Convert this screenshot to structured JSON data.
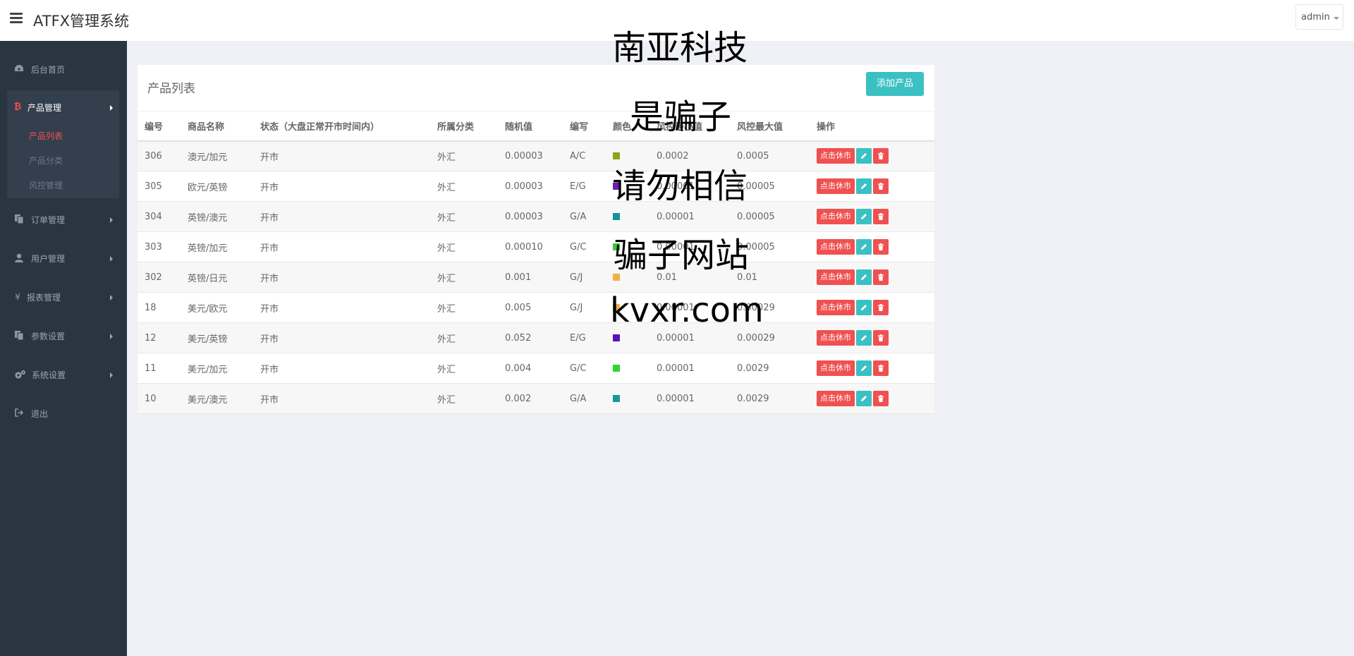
{
  "header": {
    "title": "ATFX管理系统",
    "user": "admin"
  },
  "sidebar": {
    "items": [
      {
        "label": "后台首页",
        "icon": "dashboard-icon"
      },
      {
        "label": "产品管理",
        "icon": "bitcoin-icon"
      },
      {
        "label": "订单管理",
        "icon": "copy-icon"
      },
      {
        "label": "用户管理",
        "icon": "user-icon"
      },
      {
        "label": "报表管理",
        "icon": "yen-icon"
      },
      {
        "label": "参数设置",
        "icon": "copy-icon"
      },
      {
        "label": "系统设置",
        "icon": "cogs-icon"
      },
      {
        "label": "退出",
        "icon": "sign-out-icon"
      }
    ],
    "subitems": [
      {
        "label": "产品列表"
      },
      {
        "label": "产品分类"
      },
      {
        "label": "风控管理"
      }
    ]
  },
  "panel": {
    "title": "产品列表",
    "add_label": "添加产品",
    "columns": [
      "编号",
      "商品名称",
      "状态（大盘正常开市时间内）",
      "所属分类",
      "随机值",
      "编写",
      "颜色",
      "风控最小值",
      "风控最大值",
      "操作"
    ],
    "rest_label": "点击休市",
    "rows": [
      {
        "id": "306",
        "name": "澳元/加元",
        "status": "开市",
        "category": "外汇",
        "random": "0.00003",
        "code": "A/C",
        "color": "#8aa516",
        "min": "0.0002",
        "max": "0.0005"
      },
      {
        "id": "305",
        "name": "欧元/英镑",
        "status": "开市",
        "category": "外汇",
        "random": "0.00003",
        "code": "E/G",
        "color": "#6a1bb5",
        "min": "0.00001",
        "max": "0.00005"
      },
      {
        "id": "304",
        "name": "英镑/澳元",
        "status": "开市",
        "category": "外汇",
        "random": "0.00003",
        "code": "G/A",
        "color": "#149494",
        "min": "0.00001",
        "max": "0.00005"
      },
      {
        "id": "303",
        "name": "英镑/加元",
        "status": "开市",
        "category": "外汇",
        "random": "0.00010",
        "code": "G/C",
        "color": "#3ac83a",
        "min": "0.00001",
        "max": "0.00005"
      },
      {
        "id": "302",
        "name": "英镑/日元",
        "status": "开市",
        "category": "外汇",
        "random": "0.001",
        "code": "G/J",
        "color": "#f0b040",
        "min": "0.01",
        "max": "0.01"
      },
      {
        "id": "18",
        "name": "美元/欧元",
        "status": "开市",
        "category": "外汇",
        "random": "0.005",
        "code": "G/J",
        "color": "#f0b040",
        "min": "0.00001",
        "max": "0.00029"
      },
      {
        "id": "12",
        "name": "美元/英镑",
        "status": "开市",
        "category": "外汇",
        "random": "0.052",
        "code": "E/G",
        "color": "#5a10c0",
        "min": "0.00001",
        "max": "0.00029"
      },
      {
        "id": "11",
        "name": "美元/加元",
        "status": "开市",
        "category": "外汇",
        "random": "0.004",
        "code": "G/C",
        "color": "#2ed62e",
        "min": "0.00001",
        "max": "0.0029"
      },
      {
        "id": "10",
        "name": "美元/澳元",
        "status": "开市",
        "category": "外汇",
        "random": "0.002",
        "code": "G/A",
        "color": "#159a9a",
        "min": "0.00001",
        "max": "0.0029"
      }
    ]
  },
  "watermark": [
    "南亚科技",
    "是骗子",
    "请勿相信",
    "骗子网站",
    "kvxr.com"
  ]
}
